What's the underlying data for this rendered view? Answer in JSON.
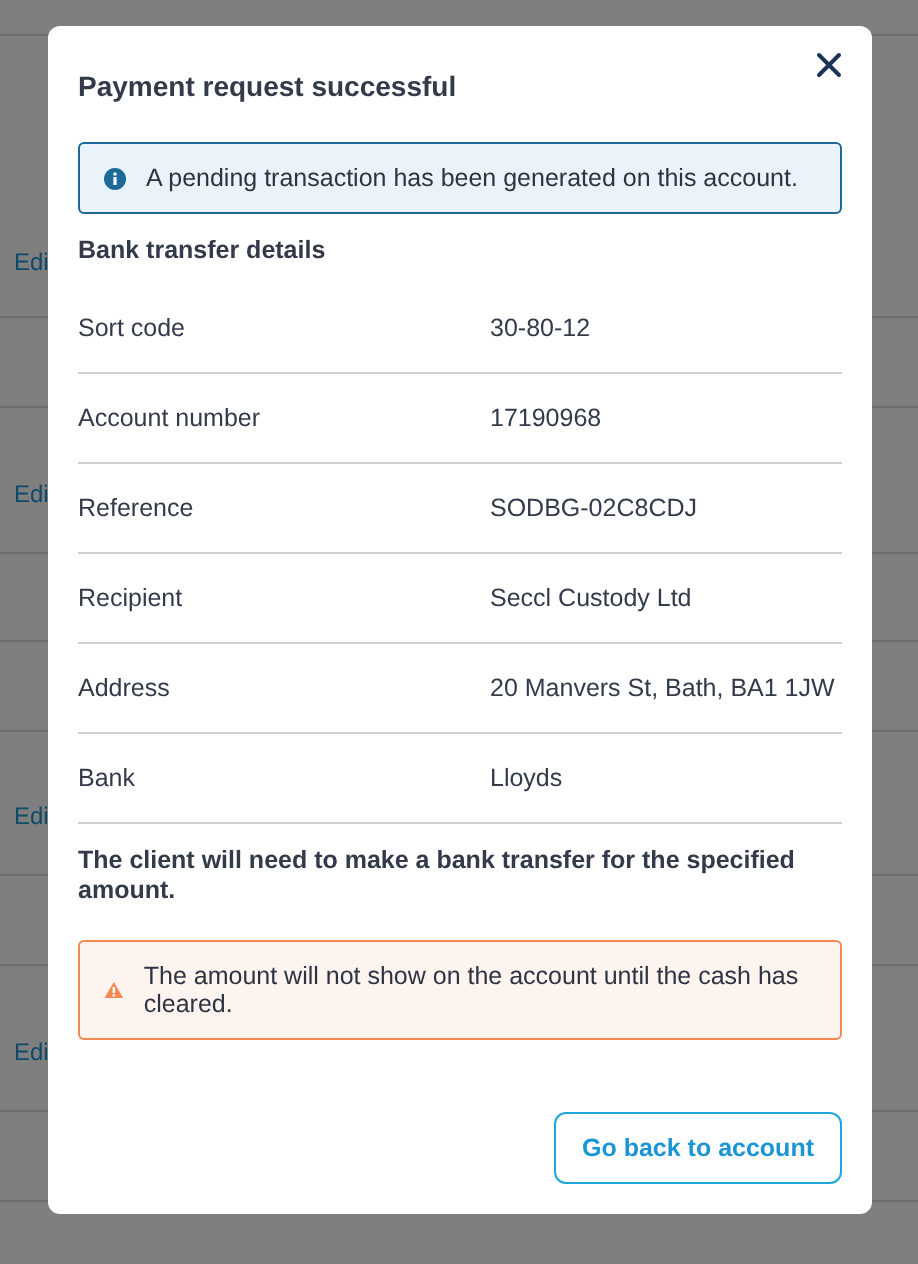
{
  "background": {
    "links": [
      "Edi",
      "Edi",
      "Edi",
      "Edi"
    ]
  },
  "dialog": {
    "title": "Payment request successful",
    "info": {
      "kind": "info",
      "text": "A pending transaction has been generated on this account."
    },
    "section_title": "Bank transfer details",
    "details": [
      {
        "label": "Sort code",
        "value": "30-80-12"
      },
      {
        "label": "Account number",
        "value": "17190968"
      },
      {
        "label": "Reference",
        "value": "SODBG-02C8CDJ"
      },
      {
        "label": "Recipient",
        "value": "Seccl Custody Ltd"
      },
      {
        "label": "Address",
        "value": "20 Manvers St, Bath, BA1 1JW"
      },
      {
        "label": "Bank",
        "value": "Lloyds"
      }
    ],
    "note": "The client will need to make a bank transfer for the specified amount.",
    "warning": {
      "kind": "warning",
      "text": "The amount will not show on the account until the cash has cleared."
    },
    "button": "Go back to account"
  }
}
